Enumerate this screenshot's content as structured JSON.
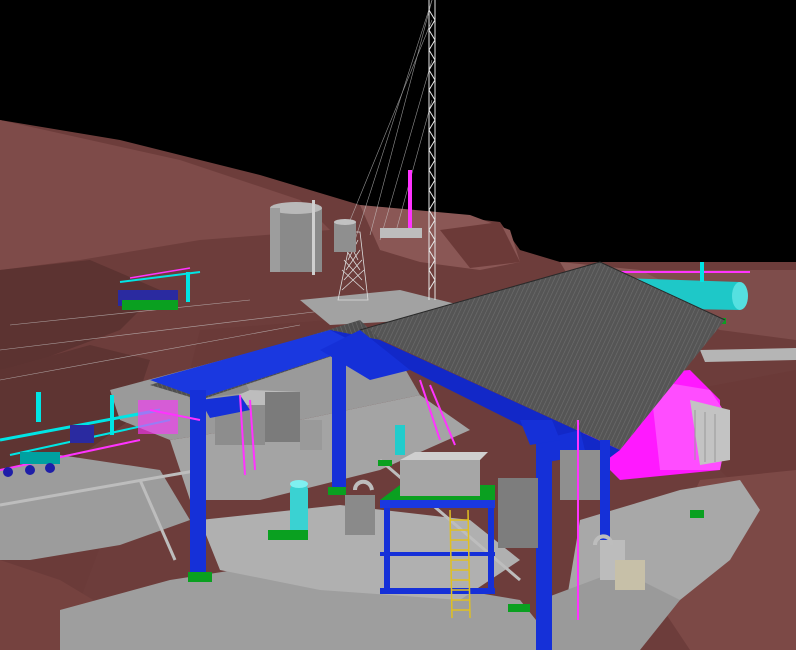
{
  "scene": {
    "description_visible_text": "",
    "colors": {
      "sky": "#000000",
      "terrain_dark": "#5a2f2f",
      "terrain_mid": "#7a4a48",
      "terrain_light": "#8e5a57",
      "pad_gray": "#a9a9a9",
      "road_gray": "#9a9a9a",
      "steel_blue": "#1530d8",
      "roof_gray": "#5c5c5c",
      "magenta": "#ff00ff",
      "cyan": "#00e5e5",
      "green": "#0aa020",
      "yellow": "#e0c020",
      "tank_gray": "#8c8c8c",
      "white_line": "#e8e8e8"
    }
  }
}
